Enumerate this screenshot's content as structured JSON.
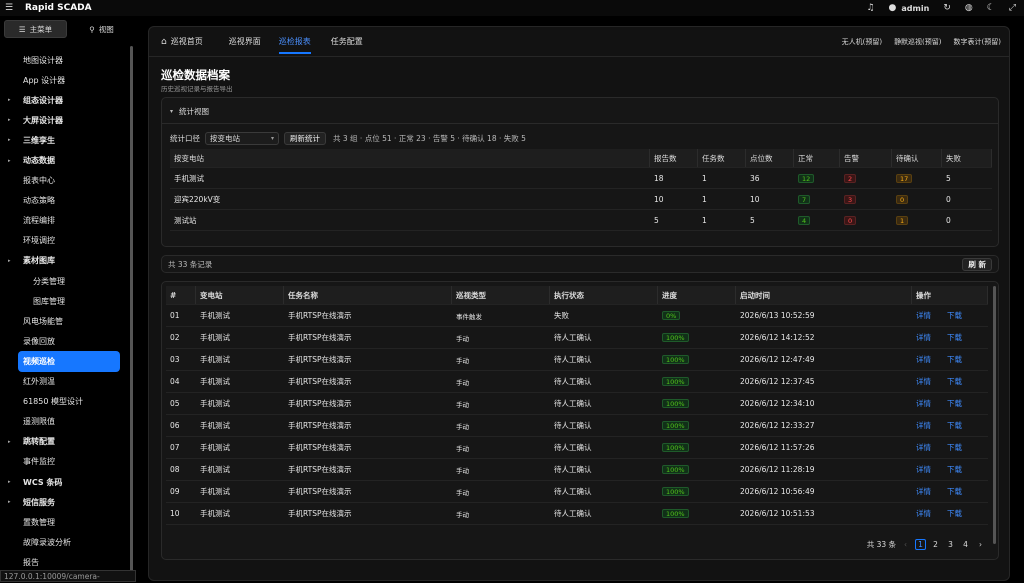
{
  "app": {
    "title": "Rapid SCADA",
    "user": "admin"
  },
  "sidebar": {
    "tabs": [
      {
        "label": "主菜单",
        "icon": "list-icon"
      },
      {
        "label": "视图",
        "icon": "sitemap-icon"
      }
    ],
    "items": [
      {
        "label": "地图设计器",
        "level": 1,
        "arrow": false
      },
      {
        "label": "App 设计器",
        "level": 1,
        "arrow": false
      },
      {
        "label": "组态设计器",
        "level": 1,
        "arrow": true
      },
      {
        "label": "大屏设计器",
        "level": 1,
        "arrow": true
      },
      {
        "label": "三维孪生",
        "level": 1,
        "arrow": true
      },
      {
        "label": "动态数据",
        "level": 1,
        "arrow": true
      },
      {
        "label": "报表中心",
        "level": 1,
        "arrow": false
      },
      {
        "label": "动态策略",
        "level": 1,
        "arrow": false
      },
      {
        "label": "流程编排",
        "level": 1,
        "arrow": false
      },
      {
        "label": "环境调控",
        "level": 1,
        "arrow": false
      },
      {
        "label": "素材图库",
        "level": 1,
        "arrow": true
      },
      {
        "label": "分类管理",
        "level": 2,
        "arrow": false
      },
      {
        "label": "图库管理",
        "level": 2,
        "arrow": false
      },
      {
        "label": "风电场能管",
        "level": 1,
        "arrow": false
      },
      {
        "label": "录像回放",
        "level": 1,
        "arrow": false
      },
      {
        "label": "视频巡检",
        "level": 1,
        "arrow": false,
        "active": true
      },
      {
        "label": "红外测温",
        "level": 1,
        "arrow": false
      },
      {
        "label": "61850 模型设计",
        "level": 1,
        "arrow": false
      },
      {
        "label": "遥测限值",
        "level": 1,
        "arrow": false
      },
      {
        "label": "跳转配置",
        "level": 1,
        "arrow": true
      },
      {
        "label": "事件监控",
        "level": 1,
        "arrow": false
      },
      {
        "label": "WCS 条码",
        "level": 1,
        "arrow": true
      },
      {
        "label": "短信服务",
        "level": 1,
        "arrow": true
      },
      {
        "label": "置数管理",
        "level": 1,
        "arrow": false
      },
      {
        "label": "故障录波分析",
        "level": 1,
        "arrow": false
      },
      {
        "label": "报告",
        "level": 1,
        "arrow": false
      }
    ],
    "status_url": "127.0.0.1:10009/camera-inspection/config"
  },
  "nav": {
    "tabs": [
      {
        "label": "巡视首页",
        "icon": "home-icon"
      },
      {
        "label": "巡视界面"
      },
      {
        "label": "巡检报表",
        "active": true
      },
      {
        "label": "任务配置"
      }
    ],
    "right": [
      "无人机(预留)",
      "静默巡视(预留)",
      "数字表计(预留)"
    ]
  },
  "page": {
    "title": "巡检数据档案",
    "subtitle": "历史巡视记录与报告导出"
  },
  "stats": {
    "header": "统计视图",
    "filter_label": "统计口径",
    "filter_value": "按变电站",
    "refresh_label": "刷新统计",
    "summary": "共 3 组 · 点位 51 · 正常 23 · 告警 5 · 待确认 18 · 失败 5",
    "columns": [
      "按变电站",
      "报告数",
      "任务数",
      "点位数",
      "正常",
      "告警",
      "待确认",
      "失败"
    ],
    "rows": [
      {
        "name": "手机测试",
        "reports": "18",
        "tasks": "1",
        "points": "36",
        "normal": "12",
        "alarm": "2",
        "pending": "17",
        "fail": "5"
      },
      {
        "name": "迎宾220kV变",
        "reports": "10",
        "tasks": "1",
        "points": "10",
        "normal": "7",
        "alarm": "3",
        "pending": "0",
        "fail": "0"
      },
      {
        "name": "测试站",
        "reports": "5",
        "tasks": "1",
        "points": "5",
        "normal": "4",
        "alarm": "0",
        "pending": "1",
        "fail": "0"
      }
    ]
  },
  "records": {
    "total_text": "共 33 条记录",
    "refresh_label": "刷 新",
    "columns": [
      "#",
      "变电站",
      "任务名称",
      "巡视类型",
      "执行状态",
      "进度",
      "启动时间",
      "操作"
    ],
    "detail_label": "详情",
    "download_label": "下载",
    "rows": [
      {
        "no": "01",
        "station": "手机测试",
        "task": "手机RTSP在线演示",
        "type": "事件触发",
        "status": "失败",
        "progress": "0%",
        "time": "2026/6/13 10:52:59"
      },
      {
        "no": "02",
        "station": "手机测试",
        "task": "手机RTSP在线演示",
        "type": "手动",
        "status": "待人工确认",
        "progress": "100%",
        "time": "2026/6/12 14:12:52"
      },
      {
        "no": "03",
        "station": "手机测试",
        "task": "手机RTSP在线演示",
        "type": "手动",
        "status": "待人工确认",
        "progress": "100%",
        "time": "2026/6/12 12:47:49"
      },
      {
        "no": "04",
        "station": "手机测试",
        "task": "手机RTSP在线演示",
        "type": "手动",
        "status": "待人工确认",
        "progress": "100%",
        "time": "2026/6/12 12:37:45"
      },
      {
        "no": "05",
        "station": "手机测试",
        "task": "手机RTSP在线演示",
        "type": "手动",
        "status": "待人工确认",
        "progress": "100%",
        "time": "2026/6/12 12:34:10"
      },
      {
        "no": "06",
        "station": "手机测试",
        "task": "手机RTSP在线演示",
        "type": "手动",
        "status": "待人工确认",
        "progress": "100%",
        "time": "2026/6/12 12:33:27"
      },
      {
        "no": "07",
        "station": "手机测试",
        "task": "手机RTSP在线演示",
        "type": "手动",
        "status": "待人工确认",
        "progress": "100%",
        "time": "2026/6/12 11:57:26"
      },
      {
        "no": "08",
        "station": "手机测试",
        "task": "手机RTSP在线演示",
        "type": "手动",
        "status": "待人工确认",
        "progress": "100%",
        "time": "2026/6/12 11:28:19"
      },
      {
        "no": "09",
        "station": "手机测试",
        "task": "手机RTSP在线演示",
        "type": "手动",
        "status": "待人工确认",
        "progress": "100%",
        "time": "2026/6/12 10:56:49"
      },
      {
        "no": "10",
        "station": "手机测试",
        "task": "手机RTSP在线演示",
        "type": "手动",
        "status": "待人工确认",
        "progress": "100%",
        "time": "2026/6/12 10:51:53"
      }
    ],
    "pager": {
      "total": "共 33 条",
      "pages": [
        "1",
        "2",
        "3",
        "4"
      ],
      "current": "1"
    }
  },
  "colors": {
    "accent": "#1677ff",
    "success": "#52c41a",
    "danger": "#ff4d4f",
    "warning": "#faad14"
  }
}
